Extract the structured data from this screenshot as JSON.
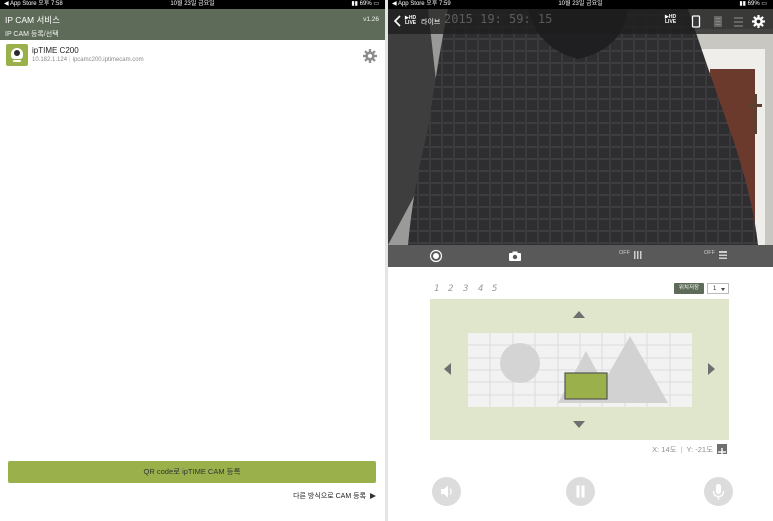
{
  "left": {
    "statusbar": {
      "left": "◀ App Store  오후 7:58",
      "center": "10월 23일 금요일",
      "right": "69%"
    },
    "header": {
      "title": "IP CAM 서비스",
      "subtitle": "IP CAM 등록/선택",
      "version": "v1.26"
    },
    "camera": {
      "name": "ipTIME C200",
      "ip": "10.182.1.124",
      "host": "ipcamc200.iptimecam.com"
    },
    "qr_button_label": "QR code로 ipTIME CAM 등록",
    "other_register_label": "다른 방식으로 CAM 등록"
  },
  "right": {
    "statusbar": {
      "left": "◀ App Store  오후 7:59",
      "center": "10월 23일 금요일",
      "right": "69%"
    },
    "topbar": {
      "live_badge_top": "▶HD",
      "live_badge_bottom": "LIVE",
      "title": "라이브",
      "osd_time": "2015  19: 59: 15"
    },
    "controls": {
      "off_label_1": "OFF",
      "off_label_2": "OFF"
    },
    "presets": [
      "1",
      "2",
      "3",
      "4",
      "5"
    ],
    "pos_save_label": "위치저장",
    "preset_select_value": "1",
    "coord": {
      "x": "X: 14도",
      "y": "Y: -21도"
    }
  },
  "colors": {
    "header": "#5e6b59",
    "accent": "#9ab04b",
    "ptz_background": "#dfe6cb"
  }
}
